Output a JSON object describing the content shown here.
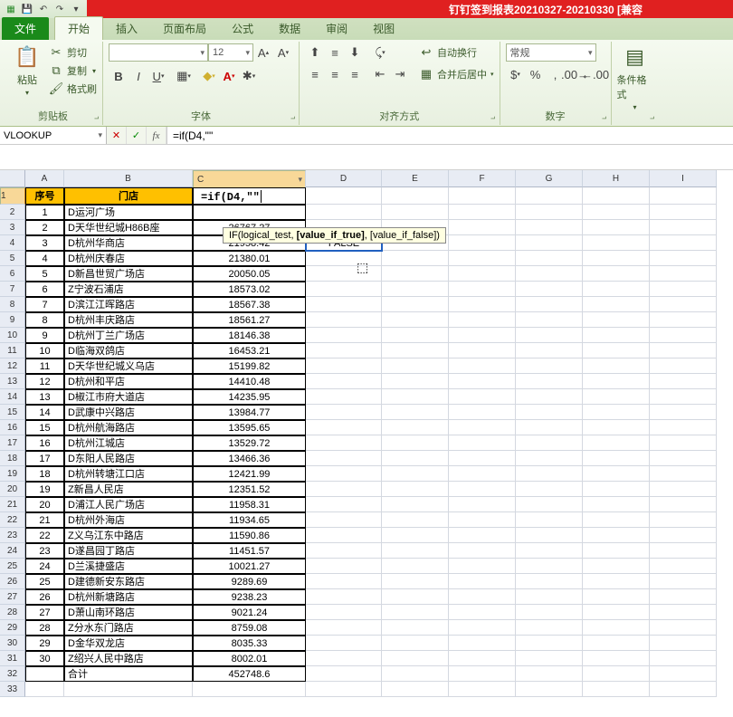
{
  "title": "钉钉签到报表20210327-20210330  [兼容",
  "tabs": {
    "file": "文件",
    "home": "开始",
    "insert": "插入",
    "layout": "页面布局",
    "formula": "公式",
    "data": "数据",
    "review": "审阅",
    "view": "视图"
  },
  "ribbon": {
    "clipboard": {
      "paste": "粘贴",
      "cut": "剪切",
      "copy": "复制",
      "format_painter": "格式刷",
      "label": "剪贴板"
    },
    "font": {
      "size": "12",
      "label": "字体"
    },
    "align": {
      "wrap": "自动换行",
      "merge": "合并后居中",
      "label": "对齐方式"
    },
    "number": {
      "general": "常规",
      "label": "数字"
    },
    "cond": {
      "label": "条件格式"
    }
  },
  "namebox": "VLOOKUP",
  "formula": "=if(D4,\"\"",
  "editing_text": "=if(D4,\"\"",
  "tooltip": {
    "fn": "IF",
    "sig1": "(logical_test, ",
    "sig2": "[value_if_true]",
    "sig3": ", [value_if_false])"
  },
  "col_headers": [
    "A",
    "B",
    "C",
    "D",
    "E",
    "F",
    "G",
    "H",
    "I"
  ],
  "headers": {
    "A": "序号",
    "B": "门店",
    "C": ""
  },
  "d4_value": "FALSE",
  "rows": [
    {
      "a": "1",
      "b": "D运河广场",
      "c": ""
    },
    {
      "a": "2",
      "b": "D天华世纪城H86B座",
      "c": "26767.27"
    },
    {
      "a": "3",
      "b": "D杭州华商店",
      "c": "21958.42"
    },
    {
      "a": "4",
      "b": "D杭州庆春店",
      "c": "21380.01"
    },
    {
      "a": "5",
      "b": "D新昌世贸广场店",
      "c": "20050.05"
    },
    {
      "a": "6",
      "b": "Z宁波石浦店",
      "c": "18573.02"
    },
    {
      "a": "7",
      "b": "D滨江江晖路店",
      "c": "18567.38"
    },
    {
      "a": "8",
      "b": "D杭州丰庆路店",
      "c": "18561.27"
    },
    {
      "a": "9",
      "b": "D杭州丁兰广场店",
      "c": "18146.38"
    },
    {
      "a": "10",
      "b": "D临海双鸽店",
      "c": "16453.21"
    },
    {
      "a": "11",
      "b": "D天华世纪城义乌店",
      "c": "15199.82"
    },
    {
      "a": "12",
      "b": "D杭州和平店",
      "c": "14410.48"
    },
    {
      "a": "13",
      "b": "D椒江市府大道店",
      "c": "14235.95"
    },
    {
      "a": "14",
      "b": "D武康中兴路店",
      "c": "13984.77"
    },
    {
      "a": "15",
      "b": "D杭州航海路店",
      "c": "13595.65"
    },
    {
      "a": "16",
      "b": "D杭州江城店",
      "c": "13529.72"
    },
    {
      "a": "17",
      "b": "D东阳人民路店",
      "c": "13466.36"
    },
    {
      "a": "18",
      "b": "D杭州转塘江口店",
      "c": "12421.99"
    },
    {
      "a": "19",
      "b": "Z新昌人民店",
      "c": "12351.52"
    },
    {
      "a": "20",
      "b": "D浦江人民广场店",
      "c": "11958.31"
    },
    {
      "a": "21",
      "b": "D杭州外海店",
      "c": "11934.65"
    },
    {
      "a": "22",
      "b": "Z义乌江东中路店",
      "c": "11590.86"
    },
    {
      "a": "23",
      "b": "D遂昌园丁路店",
      "c": "11451.57"
    },
    {
      "a": "24",
      "b": "D兰溪捷盛店",
      "c": "10021.27"
    },
    {
      "a": "25",
      "b": "D建德新安东路店",
      "c": "9289.69"
    },
    {
      "a": "26",
      "b": "D杭州新塘路店",
      "c": "9238.23"
    },
    {
      "a": "27",
      "b": "D萧山南环路店",
      "c": "9021.24"
    },
    {
      "a": "28",
      "b": "Z分水东门路店",
      "c": "8759.08"
    },
    {
      "a": "29",
      "b": "D金华双龙店",
      "c": "8035.33"
    },
    {
      "a": "30",
      "b": "Z绍兴人民中路店",
      "c": "8002.01"
    },
    {
      "a": "",
      "b": "合计",
      "c": "452748.6"
    }
  ]
}
